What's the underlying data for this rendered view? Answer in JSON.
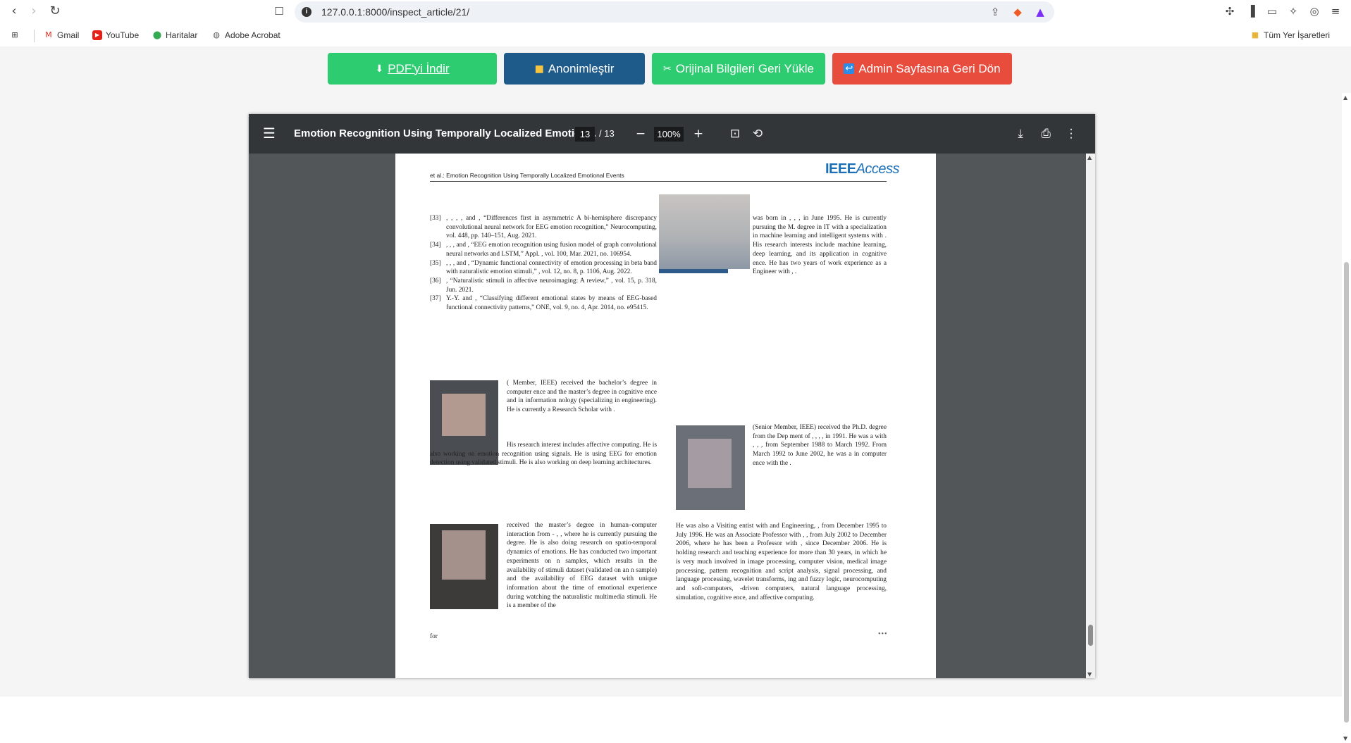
{
  "browser": {
    "url": "127.0.0.1:8000/inspect_article/21/",
    "bookmarks": [
      "Gmail",
      "YouTube",
      "Haritalar",
      "Adobe Acrobat"
    ],
    "all_bookmarks": "Tüm Yer İşaretleri"
  },
  "actions": {
    "download": "PDF'yi İndir",
    "anonymize": "Anonimleştir",
    "restore": "Orijinal Bilgileri Geri Yükle",
    "back": "Admin Sayfasına Geri Dön"
  },
  "viewer": {
    "title": "Emotion Recognition Using Temporally Localized Emotion...",
    "page": "13",
    "total": "/ 13",
    "zoom": "100%"
  },
  "pdf": {
    "header": "et al.: Emotion Recognition Using Temporally Localized Emotional Events",
    "logo_main": "IEEE",
    "logo_sub": "Access",
    "refs": [
      {
        "n": "[33]",
        "t": ",          ,          ,          , and          , “Differences first in asymmetric          A bi-hemisphere discrepancy convolutional neural network for EEG emotion recognition,” Neurocomputing, vol. 448, pp. 140–151, Aug. 2021."
      },
      {
        "n": "[34]",
        "t": ",          ,          , and          , “EEG emotion recognition using fusion model of graph convolutional neural networks and LSTM,” Appl.          , vol. 100, Mar. 2021,          no. 106954."
      },
      {
        "n": "[35]",
        "t": ",          ,          , and          , “Dynamic functional connectivity of emotion processing in beta band with naturalistic emotion stimuli,”          , vol. 12, no. 8, p. 1106, Aug. 2022."
      },
      {
        "n": "[36]",
        "t": "          , “Naturalistic stimuli in affective neuroimaging: A review,”          , vol. 15, p. 318, Jun. 2021."
      },
      {
        "n": "[37]",
        "t": "Y.-Y.          and          , “Classifying different emotional states by means of EEG-based functional connectivity patterns,”          ONE, vol. 9, no. 4, Apr. 2014,          no. e95415."
      }
    ],
    "bio1": "                              (                    Member, IEEE) received the bachelor’s degree in computer          ence and the master’s degree in cognitive          ence and in information          nology (specializing in          engineering). He is currently a Research Scholar with                                        .",
    "bio1b": "His research interest includes affective computing. He is also working on emotion recognition using          signals. He is using EEG for emotion detection using validated stimuli. He is also working on deep learning architectures.",
    "bio2": "                              received the master’s degree in human–computer interaction from          -                    ,          , where he is currently pursuing the          degree. He is also doing research on spatio-temporal dynamics of emotions. He has conducted two important experiments on          n samples, which results in the availability of stimuli dataset (validated on an          n sample) and the availability of EEG dataset with unique information about the time of emotional experience during watching the naturalistic multimedia stimuli. He is a member of the",
    "bio2b": "for",
    "bio3": "                              was born in          ,          ,          , in June 1995. He is currently pursuing the M.          degree in IT with a specialization in machine learning and intelligent systems with                                        . His research interests include machine learning, deep learning, and its application in cognitive          ence. He has two years of work experience as a          Engineer with          ,          .",
    "bio4": "                              (Senior Member, IEEE) received the Ph.D. degree from the Dep     ment of                    ,          ,          ,          , in 1991. He was a          with          ,          ,          , from September 1988 to March 1992. From March 1992 to June 2002, he was a          in computer          ence with the                    .",
    "bio4b": "He was also a Visiting          entist with                    and Engineering,          , from December 1995 to July 1996. He was an Associate Professor with                    ,          , from July 2002 to December 2006, where he has been a Professor with                              , since December 2006. He is holding research and teaching experience for more than 30 years, in which he is very much involved in image processing, computer vision, medical image processing, pattern recognition and script analysis,          signal processing,          and language processing, wavelet transforms,          ing and fuzzy logic, neurocomputing and soft-computers,          -driven computers, natural language processing, simulation, cognitive          ence, and affective computing.",
    "end_mark": "•••"
  }
}
